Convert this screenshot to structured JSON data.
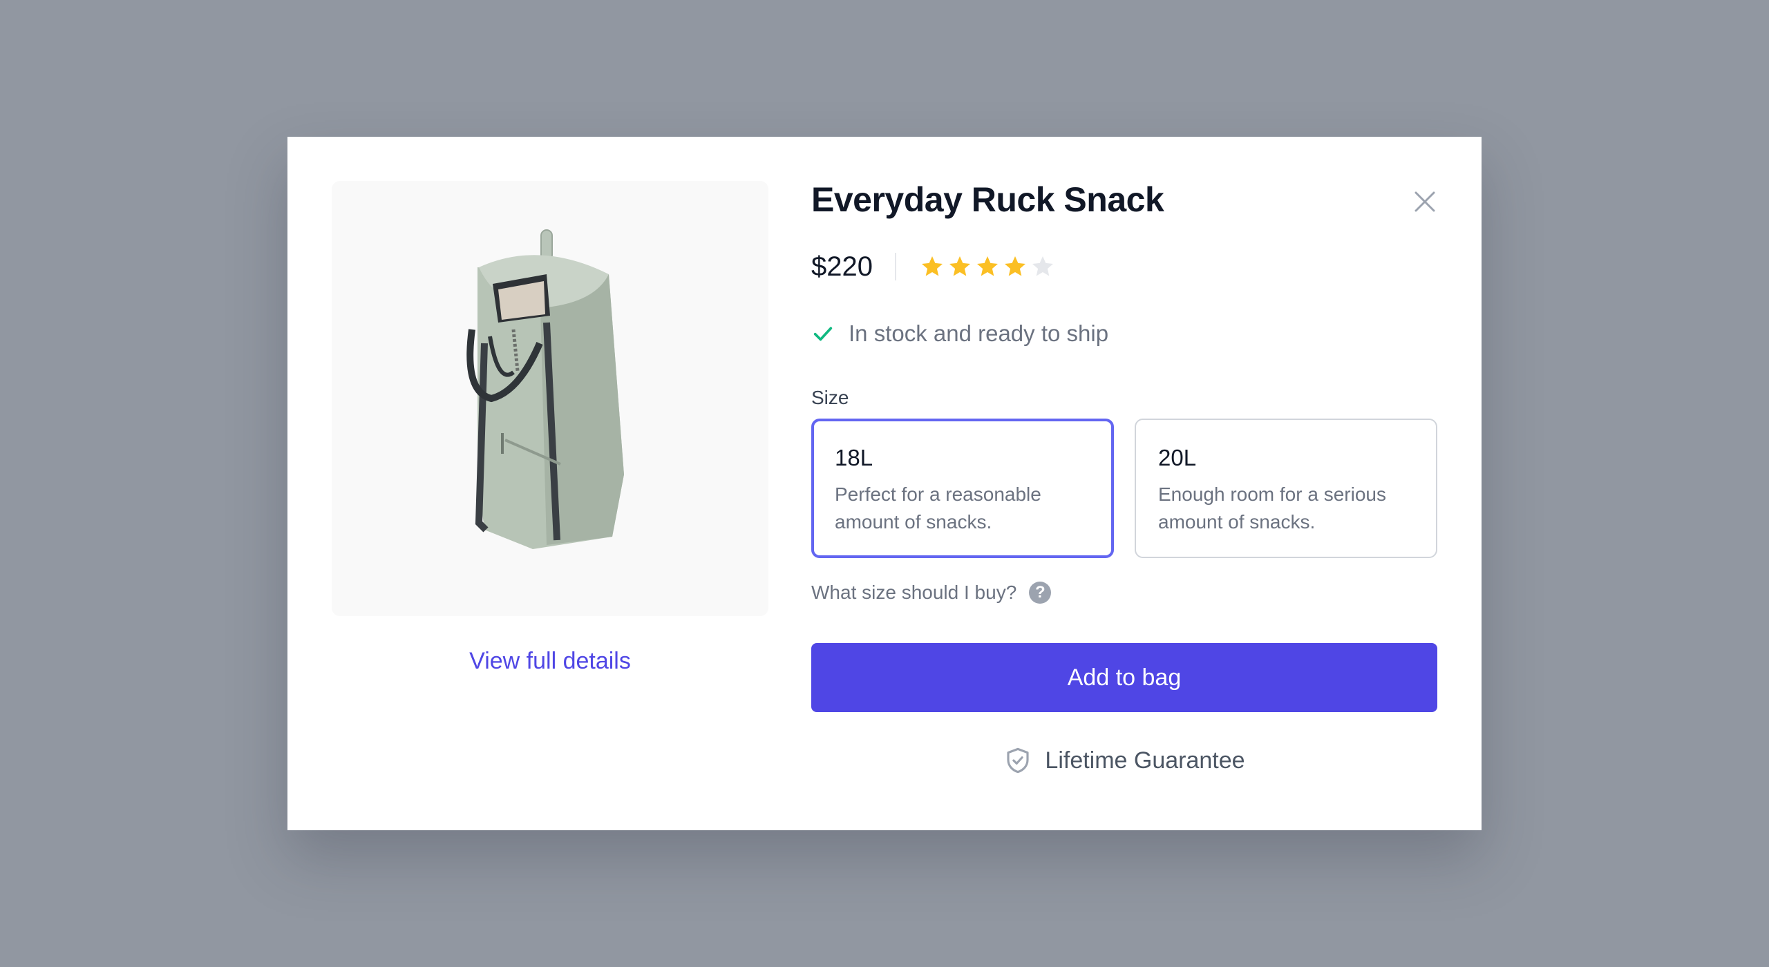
{
  "product": {
    "title": "Everyday Ruck Snack",
    "price": "$220",
    "rating": {
      "value": 4,
      "max": 5
    },
    "image_alt": "green-canvas-tote-backpack",
    "view_details_label": "View full details"
  },
  "availability": {
    "text": "In stock and ready to ship",
    "icon": "check-icon"
  },
  "size": {
    "label": "Size",
    "options": [
      {
        "name": "18L",
        "description": "Perfect for a reasonable amount of snacks.",
        "selected": true
      },
      {
        "name": "20L",
        "description": "Enough room for a serious amount of snacks.",
        "selected": false
      }
    ],
    "help_text": "What size should I buy?",
    "help_icon": "?"
  },
  "actions": {
    "add_to_bag_label": "Add to bag",
    "close_icon": "close-icon"
  },
  "guarantee": {
    "text": "Lifetime Guarantee",
    "icon": "shield-check-icon"
  },
  "colors": {
    "accent": "#4f46e5",
    "selected_border": "#6366f1",
    "star_filled": "#fbbf24",
    "star_empty": "#e5e7eb",
    "check": "#10b981",
    "backdrop": "#9197a1"
  }
}
